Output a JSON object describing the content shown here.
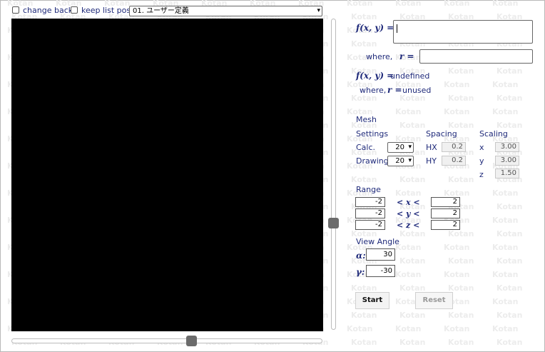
{
  "header": {
    "change_back_label": "change back",
    "keep_list_pos_label": "keep list pos.",
    "preset_selected": "01. ユーザー定義"
  },
  "watermark_text": "Kotan",
  "formula": {
    "f_label": "f(x, y) =",
    "f_value": "",
    "where_label": "where,",
    "r_label": "r =",
    "r_value": "",
    "f_status_label": "f(x, y) =",
    "f_status_value": "undefined",
    "where_status_label": "where,",
    "r_status_label": "r =",
    "r_status_value": "unused"
  },
  "mesh": {
    "title": "Mesh",
    "settings_label": "Settings",
    "calc_label": "Calc.",
    "calc_value": "20",
    "drawing_label": "Drawing",
    "drawing_value": "20"
  },
  "spacing": {
    "title": "Spacing",
    "hx_label": "HX",
    "hx_value": "0.2",
    "hy_label": "HY",
    "hy_value": "0.2"
  },
  "scaling": {
    "title": "Scaling",
    "x_label": "x",
    "x_value": "3.00",
    "y_label": "y",
    "y_value": "3.00",
    "z_label": "z",
    "z_value": "1.50"
  },
  "range": {
    "title": "Range",
    "x_min": "-2",
    "x_label": "< x <",
    "x_max": "2",
    "y_min": "-2",
    "y_label": "< y <",
    "y_max": "2",
    "z_min": "-2",
    "z_label": "< z <",
    "z_max": "2"
  },
  "view_angle": {
    "title": "View Angle",
    "alpha_label": "α:",
    "alpha_value": "30",
    "gamma_label": "γ:",
    "gamma_value": "-30"
  },
  "buttons": {
    "start_label": "Start",
    "reset_label": "Reset"
  },
  "sliders": {
    "vertical_fraction": 0.66,
    "horizontal_fraction": 0.58
  },
  "colors": {
    "accent_text": "#1f2a7a",
    "canvas_bg": "#000000",
    "thumb": "#6b6b6b"
  }
}
